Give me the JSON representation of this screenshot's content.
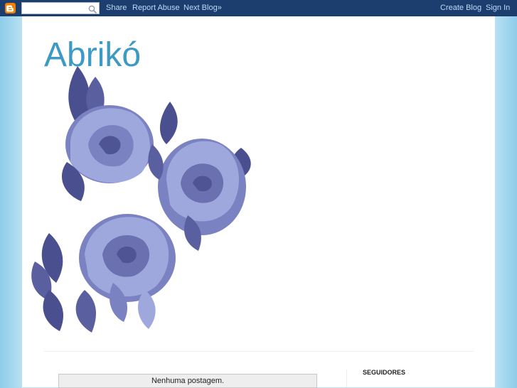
{
  "navbar": {
    "search": {
      "value": "",
      "placeholder": ""
    },
    "share_label": "Share",
    "report_abuse_label": "Report Abuse",
    "next_blog_label": "Next Blog»",
    "create_blog_label": "Create Blog",
    "sign_in_label": "Sign In",
    "icons": {
      "logo": "blogger-logo-icon",
      "search": "search-icon"
    }
  },
  "header": {
    "title": "Abrikó",
    "image": "blue-roses-illustration"
  },
  "main": {
    "status_message": "Nenhuma postagem."
  },
  "sidebar": {
    "followers_heading": "SEGUIDORES"
  },
  "colors": {
    "navbar_bg": "#1c3e6e",
    "nav_link": "#bfd8f7",
    "title": "#3c9ac5",
    "background": "#b8e0f2",
    "logo": "#f57d00",
    "rose_dark": "#4a4f8f",
    "rose_light": "#9ea8dd"
  }
}
